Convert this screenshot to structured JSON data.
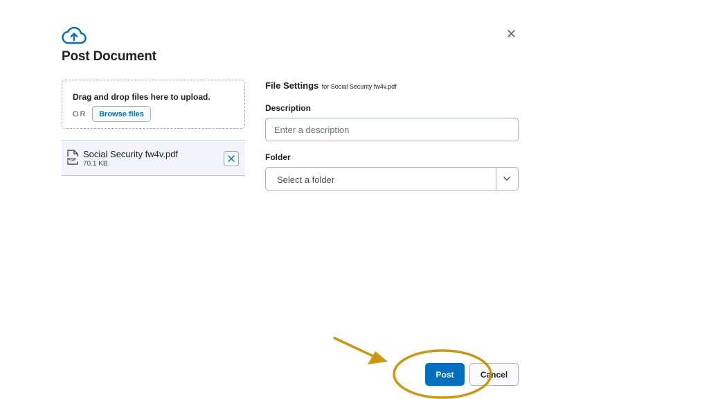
{
  "dialog": {
    "title": "Post Document",
    "close_icon": "close-icon",
    "header_icon": "cloud-upload-icon"
  },
  "upload": {
    "dropzone_text": "Drag and drop files here to upload.",
    "or_label": "OR",
    "browse_label": "Browse files"
  },
  "file": {
    "icon": "pdf-file-icon",
    "name": "Social Security fw4v.pdf",
    "size": "70.1 KB",
    "remove_icon": "close-icon"
  },
  "settings": {
    "title": "File Settings",
    "subtitle": "for Social Security fw4v.pdf",
    "description_label": "Description",
    "description_placeholder": "Enter a description",
    "description_value": "",
    "folder_label": "Folder",
    "folder_placeholder": "Select a folder",
    "folder_icon": "chevron-down-icon"
  },
  "actions": {
    "post_label": "Post",
    "cancel_label": "Cancel"
  },
  "colors": {
    "primary": "#006fbf",
    "annotation": "#c9980f",
    "file_row_bg": "#f1f5fb"
  }
}
